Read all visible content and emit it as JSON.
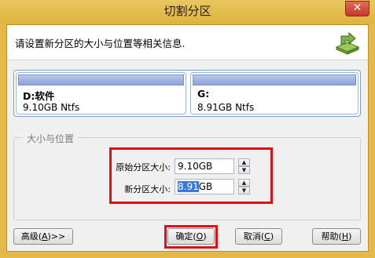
{
  "window": {
    "title": "切割分区",
    "close_glyph": "✕"
  },
  "header": {
    "instruction": "请设置新分区的大小与位置等相关信息.",
    "icon": "partition-split-icon"
  },
  "partitions": [
    {
      "name": "D:软件",
      "size": "9.10GB Ntfs"
    },
    {
      "name": "G:",
      "size": "8.91GB Ntfs"
    }
  ],
  "size_group": {
    "label": "大小与位置",
    "original_label": "原始分区大小:",
    "original_value": "9.10GB",
    "new_label": "新分区大小:",
    "new_value_selected": "8.91",
    "new_value_unit": "GB"
  },
  "buttons": {
    "advanced": {
      "label": "高级(",
      "key": "A",
      "suffix": ")>>"
    },
    "ok": {
      "label": "确定(",
      "key": "O",
      "suffix": ")"
    },
    "cancel": {
      "label": "取消(",
      "key": "C",
      "suffix": ")"
    },
    "help": {
      "label": "帮助(",
      "key": "H",
      "suffix": ")"
    }
  },
  "colors": {
    "highlight": "#e01010",
    "title_bar": "#e5b947"
  }
}
